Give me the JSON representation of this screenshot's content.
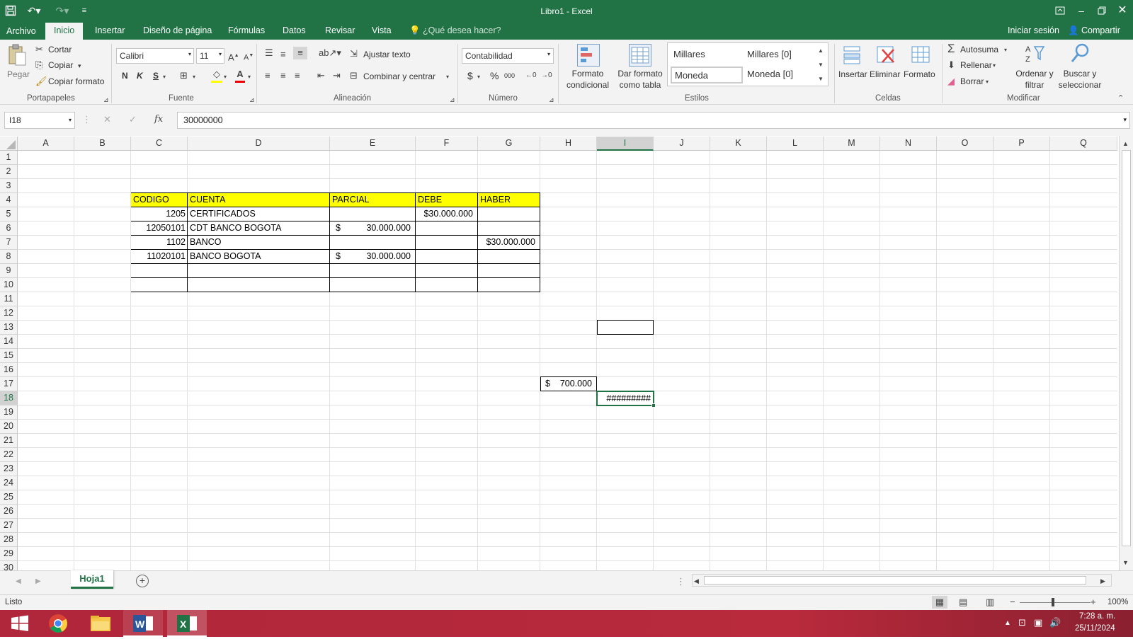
{
  "titlebar": {
    "title": "Libro1 - Excel"
  },
  "menu": {
    "archivo": "Archivo",
    "tabs": [
      "Inicio",
      "Insertar",
      "Diseño de página",
      "Fórmulas",
      "Datos",
      "Revisar",
      "Vista"
    ],
    "tell_me": "¿Qué desea hacer?",
    "sign_in": "Iniciar sesión",
    "share": "Compartir"
  },
  "ribbon": {
    "clipboard": {
      "paste": "Pegar",
      "cut": "Cortar",
      "copy": "Copiar",
      "format_painter": "Copiar formato",
      "label": "Portapapeles"
    },
    "font": {
      "name": "Calibri",
      "size": "11",
      "bold": "N",
      "italic": "K",
      "underline": "S",
      "label": "Fuente"
    },
    "alignment": {
      "wrap": "Ajustar texto",
      "merge": "Combinar y centrar",
      "label": "Alineación"
    },
    "number": {
      "format": "Contabilidad",
      "currency": "$",
      "percent": "%",
      "thousands": "000",
      "label": "Número"
    },
    "styles": {
      "conditional": "Formato condicional",
      "as_table": "Dar formato como tabla",
      "gallery": [
        "Millares",
        "Millares [0]",
        "Moneda",
        "Moneda [0]"
      ],
      "label": "Estilos"
    },
    "cells": {
      "insert": "Insertar",
      "delete": "Eliminar",
      "format": "Formato",
      "label": "Celdas"
    },
    "editing": {
      "autosum": "Autosuma",
      "fill": "Rellenar",
      "clear": "Borrar",
      "sort": "Ordenar y filtrar",
      "find": "Buscar y seleccionar",
      "label": "Modificar"
    }
  },
  "formula_bar": {
    "name_box": "I18",
    "fx": "fx",
    "value": "30000000"
  },
  "sheet": {
    "columns": [
      "A",
      "B",
      "C",
      "D",
      "E",
      "F",
      "G",
      "H",
      "I",
      "J",
      "K",
      "L",
      "M",
      "N",
      "O",
      "P",
      "Q"
    ],
    "rows": [
      "1",
      "2",
      "3",
      "4",
      "5",
      "6",
      "7",
      "8",
      "9",
      "10",
      "11",
      "12",
      "13",
      "14",
      "15",
      "16",
      "17",
      "18",
      "19",
      "20",
      "21",
      "22",
      "23",
      "24",
      "25",
      "26",
      "27",
      "28",
      "29",
      "30"
    ],
    "selected_cell": "I18",
    "header": {
      "codigo": "CODIGO",
      "cuenta": "CUENTA",
      "parcial": "PARCIAL",
      "debe": "DEBE",
      "haber": "HABER"
    },
    "table": [
      {
        "codigo": "1205",
        "cuenta": "CERTIFICADOS",
        "parcial_sym": "",
        "parcial": "",
        "debe": "$30.000.000",
        "haber": ""
      },
      {
        "codigo": "12050101",
        "cuenta": "CDT BANCO BOGOTA",
        "parcial_sym": "$",
        "parcial": "30.000.000",
        "debe": "",
        "haber": ""
      },
      {
        "codigo": "1102",
        "cuenta": "BANCO",
        "parcial_sym": "",
        "parcial": "",
        "debe": "",
        "haber": "$30.000.000"
      },
      {
        "codigo": "11020101",
        "cuenta": "BANCO BOGOTA",
        "parcial_sym": "$",
        "parcial": "30.000.000",
        "debe": "",
        "haber": ""
      },
      {
        "codigo": "",
        "cuenta": "",
        "parcial_sym": "",
        "parcial": "",
        "debe": "",
        "haber": ""
      },
      {
        "codigo": "",
        "cuenta": "",
        "parcial_sym": "",
        "parcial": "",
        "debe": "",
        "haber": ""
      }
    ],
    "h17_symbol": "$",
    "h17_value": "700.000",
    "i18_value": "#########"
  },
  "sheet_tabs": {
    "active": "Hoja1"
  },
  "status": {
    "ready": "Listo",
    "zoom": "100%"
  },
  "taskbar": {
    "time": "7:28 a. m.",
    "date": "25/11/2024"
  },
  "colors": {
    "excel_green": "#217346",
    "header_yellow": "#ffff00",
    "taskbar_red": "#b0263a"
  }
}
